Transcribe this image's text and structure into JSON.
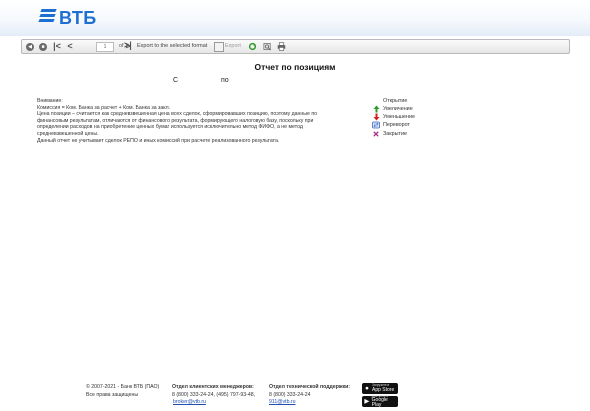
{
  "header": {
    "logo_text": "ВТБ"
  },
  "toolbar": {
    "page_value": "1",
    "of_label": "of 1",
    "export_label": "Export to the selected format",
    "export_link": "Export"
  },
  "report": {
    "title": "Отчет по позициям",
    "from_label": "С",
    "to_label": "по"
  },
  "notes": {
    "heading": "Внимание:",
    "line1": "Комиссия = Ком. Банка за расчет + Ком. Банка за закл.",
    "line2": "Цена позиции – считается как средневзвешенная цена всех сделок, сформировавших позицию, поэтому данные по финансовым результатам, отличаются от финансового результата, формирующего налоговую базу, поскольку при определении расходов на приобретение ценных бумаг используется исключительно метод ФИФО, а не метод средневзвешенной цены.",
    "line3": "Данный отчет не учитывает сделок РЕПО и иных комиссий при расчете реализованного результата."
  },
  "legend": {
    "items": [
      {
        "label": "Открытие",
        "icon": "none"
      },
      {
        "label": "Увеличение",
        "icon": "arrow-up-icon",
        "color": "#2e9a2e"
      },
      {
        "label": "Уменьшение",
        "icon": "arrow-down-icon",
        "color": "#d02020"
      },
      {
        "label": "Переворот",
        "icon": "swap-icon",
        "color": "#3b66c4"
      },
      {
        "label": "Закрытие",
        "icon": "close-icon",
        "color": "#a32a8a"
      }
    ]
  },
  "footer": {
    "copyright": "© 2007-2021 - Банк ВТБ (ПАО)",
    "rights": "Все права защищены",
    "managers_title": "Отдел клиентских менеджеров:",
    "managers_phones": "8 (800) 333-24-24, (495) 797-93-48,",
    "managers_email": "broker@vtb.ru",
    "support_title": "Отдел технической поддержки:",
    "support_phone": "8 (800) 333-24-24",
    "support_email": "911@vtb.ru",
    "appstore_small": "Загрузите в",
    "appstore_label": "App Store",
    "googleplay_small": "Доступно в",
    "googleplay_label": "Google Play"
  },
  "colors": {
    "brand": "#1f6fd1",
    "link": "#1f4fb0"
  }
}
